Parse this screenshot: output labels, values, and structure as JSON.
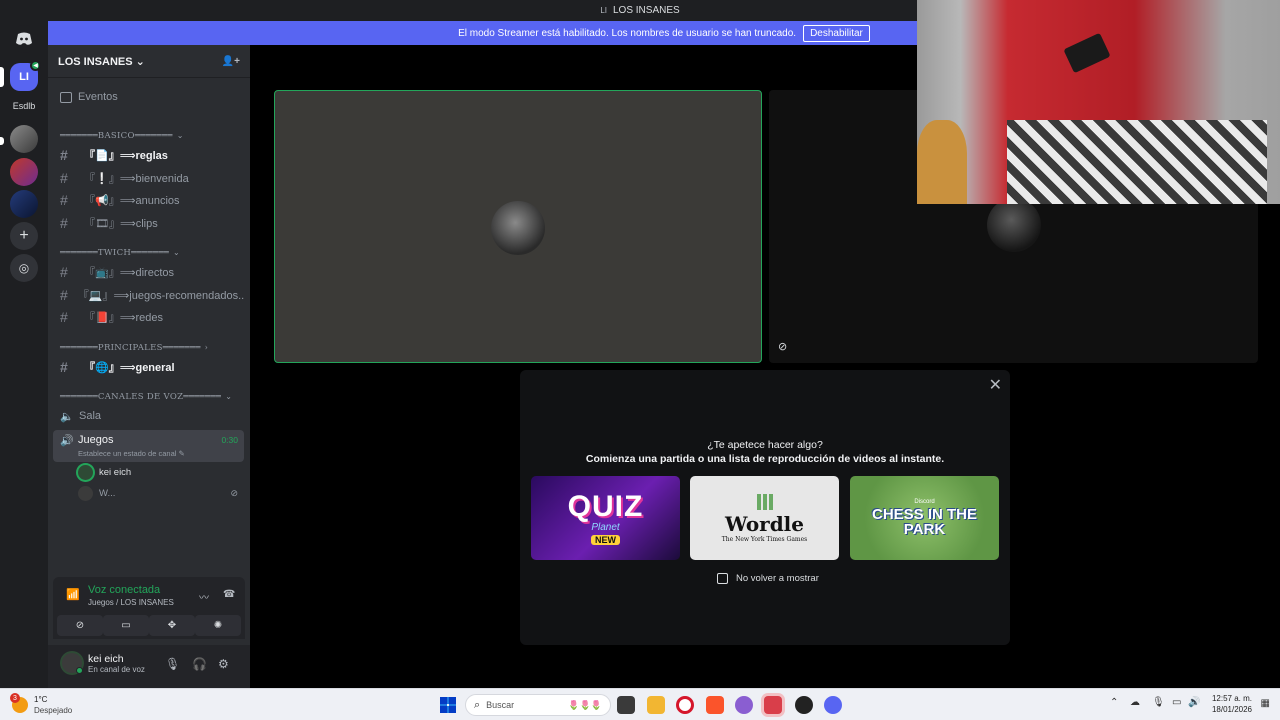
{
  "window": {
    "title": "LOS INSANES",
    "server_glyph": "LI"
  },
  "banner": {
    "text": "El modo Streamer está habilitado. Los nombres de usuario se han truncado.",
    "button": "Deshabilitar"
  },
  "rail": {
    "active_server_initials": "LI",
    "active_server_badge": "◀",
    "server_label": "Esdlb",
    "add_glyph": "+",
    "explore_glyph": "◎"
  },
  "guild": {
    "name": "LOS INSANES",
    "chevron": "⌄",
    "invite_glyph": "👤+",
    "events": "Eventos"
  },
  "categories": {
    "basico": "═══════BASICO═══════",
    "twich": "═══════TWICH═══════",
    "principales": "═══════PRINCIPALES═══════",
    "voz": "═══════CANALES DE VOZ═══════"
  },
  "channels": {
    "reglas": "⟹reglas",
    "reglas_icon": "『📄』",
    "bienvenida": "⟹bienvenida",
    "bienvenida_icon": "『❕』",
    "anuncios": "⟹anuncios",
    "anuncios_icon": "『📢』",
    "clips": "⟹clips",
    "clips_icon": "『🎞』",
    "directos": "⟹directos",
    "directos_icon": "『📺』",
    "juegos_rec": "⟹juegos-recomendados...",
    "juegos_rec_icon": "『💻』",
    "redes": "⟹redes",
    "redes_icon": "『📕』",
    "general": "⟹general",
    "general_icon": "『🌐』"
  },
  "voice": {
    "sala": "Sala",
    "juegos": "Juegos",
    "juegos_status": "Establece un estado de canal ✎",
    "juegos_timer": "0:30",
    "user1": "kei eich",
    "user2": "W..."
  },
  "connection": {
    "title": "Voz conectada",
    "subtitle": "Juegos / LOS INSANES"
  },
  "user": {
    "name": "kei eich",
    "status": "En canal de voz"
  },
  "activity": {
    "question": "¿Te apetece hacer algo?",
    "subtitle": "Comienza una partida o una lista de reproducción de videos al instante.",
    "cards": [
      {
        "title": "QUIZ",
        "sub": "Planet",
        "badge": "NEW"
      },
      {
        "title": "Wordle",
        "sub": "The New York Times Games"
      },
      {
        "title": "CHESS IN THE PARK",
        "brand": "Discord"
      }
    ],
    "dont_show": "No volver a mostrar",
    "close_glyph": "✕"
  },
  "taskbar": {
    "weather_badge": "3",
    "temperature": "1°C",
    "condition": "Despejado",
    "search_placeholder": "Buscar",
    "search_deco": "🌷🌷🌷",
    "time": "12:57 a. m.",
    "date": "18/01/2026"
  },
  "colors": {
    "blurple": "#5865f2",
    "green": "#23a55a",
    "sidebar": "#2b2d31",
    "rail": "#1e1f22"
  }
}
